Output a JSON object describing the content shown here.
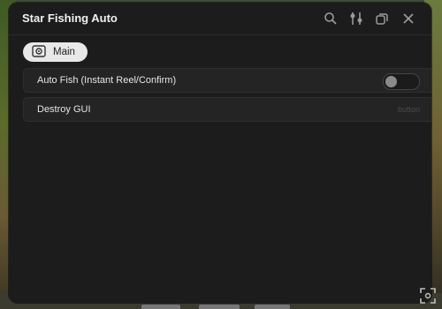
{
  "window": {
    "title": "Star Fishing Auto"
  },
  "titlebar_icons": [
    "search-icon",
    "settings-sliders-icon",
    "minimize-icon",
    "close-icon"
  ],
  "tabs": [
    {
      "label": "Main",
      "icon": "tab-icon"
    }
  ],
  "main": {
    "auto_fish": {
      "label": "Auto Fish (Instant Reel/Confirm)",
      "toggle_on": false
    },
    "destroy_gui": {
      "label": "Destroy GUI",
      "hint": "button"
    }
  },
  "colors": {
    "window_bg": "#1c1c1c",
    "row_bg": "#242424",
    "tab_bg": "#e8e8e8",
    "text": "#e6e6e6"
  }
}
